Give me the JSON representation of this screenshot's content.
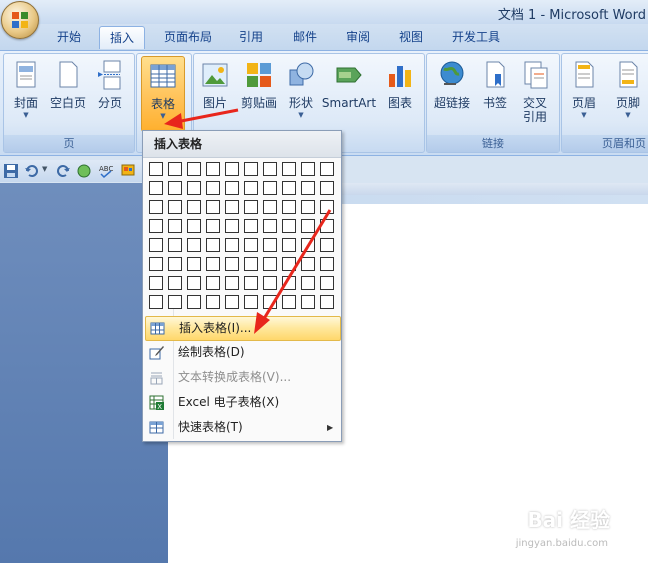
{
  "window": {
    "title": "文档 1 - Microsoft Word"
  },
  "tabs": [
    "开始",
    "插入",
    "页面布局",
    "引用",
    "邮件",
    "审阅",
    "视图",
    "开发工具"
  ],
  "active_tab": "插入",
  "ribbon": {
    "page_group": {
      "label": "页",
      "buttons": [
        "封面",
        "空白页",
        "分页"
      ]
    },
    "table_button": {
      "label": "表格"
    },
    "illustration_buttons": [
      "图片",
      "剪贴画",
      "形状",
      "SmartArt",
      "图表"
    ],
    "links_group": {
      "label": "链接",
      "buttons": [
        "超链接",
        "书签",
        "交叉\n引用"
      ]
    },
    "header_group": {
      "label": "页眉和页",
      "buttons": [
        "页眉",
        "页脚"
      ]
    }
  },
  "menu": {
    "title": "插入表格",
    "grid": {
      "cols": 10,
      "rows": 8
    },
    "items": [
      {
        "label": "插入表格(I)...",
        "icon": "insert-table-icon",
        "highlighted": true
      },
      {
        "label": "绘制表格(D)",
        "icon": "draw-table-icon"
      },
      {
        "label": "文本转换成表格(V)...",
        "icon": "convert-text-icon",
        "disabled": true
      },
      {
        "label": "Excel 电子表格(X)",
        "icon": "excel-icon"
      },
      {
        "label": "快速表格(T)",
        "icon": "quick-table-icon",
        "submenu": true
      }
    ]
  },
  "watermark": {
    "text": "Bai 经验",
    "sub": "jingyan.baidu.com"
  },
  "colors": {
    "accent": "#ffc35a",
    "arrow": "#e8261c",
    "tab_text": "#15428b"
  }
}
